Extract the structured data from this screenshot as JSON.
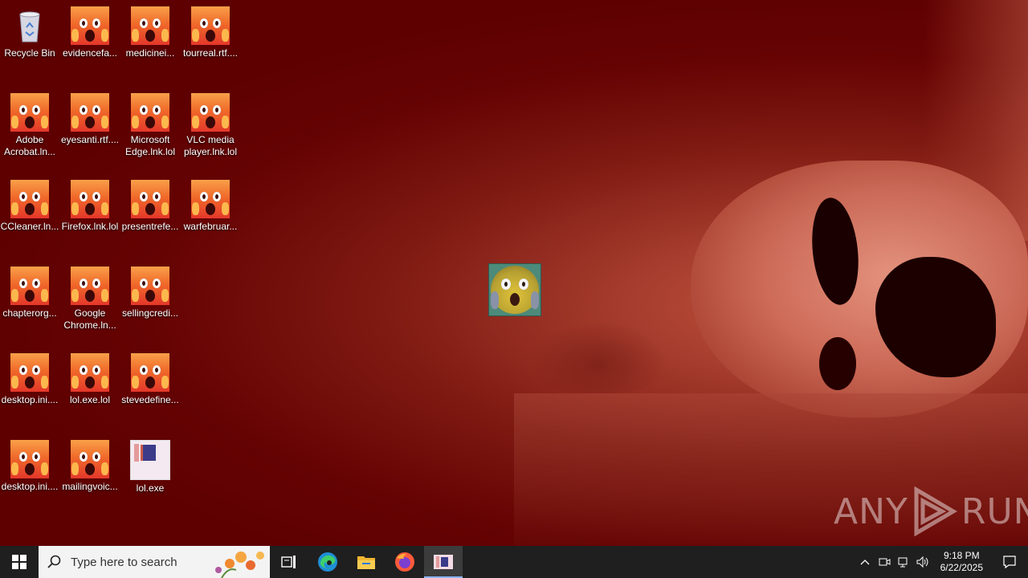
{
  "desktop": {
    "icons": [
      {
        "label": "Recycle Bin",
        "type": "recycle"
      },
      {
        "label": "evidencefa...",
        "type": "scream"
      },
      {
        "label": "medicinei...",
        "type": "scream"
      },
      {
        "label": "tourreal.rtf....",
        "type": "scream"
      },
      {
        "label": "Adobe Acrobat.ln...",
        "type": "scream"
      },
      {
        "label": "eyesanti.rtf....",
        "type": "scream"
      },
      {
        "label": "Microsoft Edge.lnk.lol",
        "type": "scream"
      },
      {
        "label": "VLC media player.lnk.lol",
        "type": "scream"
      },
      {
        "label": "CCleaner.ln...",
        "type": "scream"
      },
      {
        "label": "Firefox.lnk.lol",
        "type": "scream"
      },
      {
        "label": "presentrefe...",
        "type": "scream"
      },
      {
        "label": "warfebruar...",
        "type": "scream"
      },
      {
        "label": "chapterorg...",
        "type": "scream"
      },
      {
        "label": "Google Chrome.ln...",
        "type": "scream"
      },
      {
        "label": "sellingcredi...",
        "type": "scream"
      },
      {
        "label": "desktop.ini....",
        "type": "scream"
      },
      {
        "label": "lol.exe.lol",
        "type": "scream"
      },
      {
        "label": "stevedefine...",
        "type": "scream"
      },
      {
        "label": "desktop.ini....",
        "type": "scream"
      },
      {
        "label": "mailingvoic...",
        "type": "scream"
      },
      {
        "label": "lol.exe",
        "type": "exe"
      }
    ]
  },
  "watermark": {
    "left": "ANY",
    "right": "RUN"
  },
  "taskbar": {
    "search_placeholder": "Type here to search",
    "apps": [
      "start-icon",
      "task-view-icon",
      "edge-icon",
      "file-explorer-icon",
      "firefox-icon",
      "lol-exe-icon"
    ],
    "clock": {
      "time": "9:18 PM",
      "date": "6/22/2025"
    }
  },
  "colors": {
    "desktop_bg": "#5e0000",
    "taskbar_bg": "#1f1f1f",
    "accent": "#8ab4f8"
  }
}
